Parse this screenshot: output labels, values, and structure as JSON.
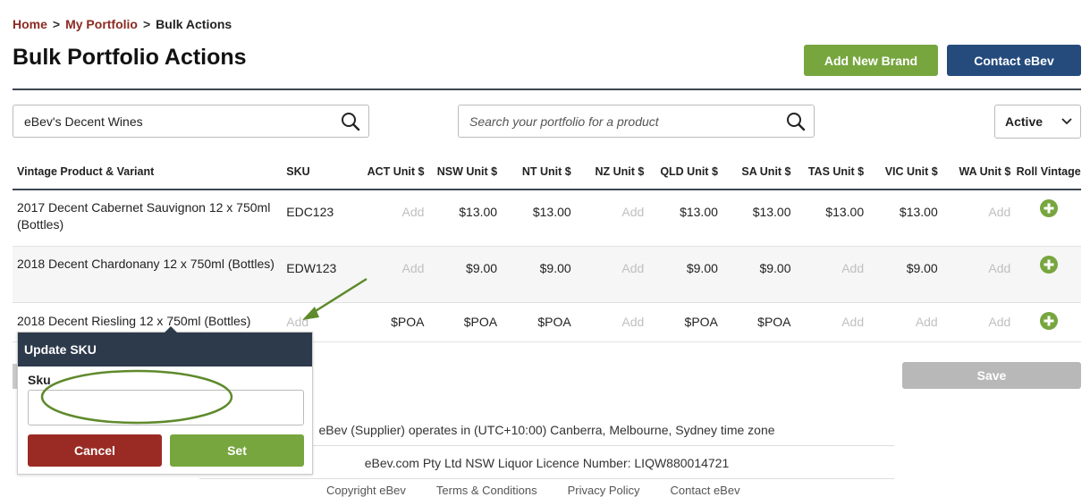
{
  "breadcrumb": {
    "home": "Home",
    "portfolio": "My Portfolio",
    "current": "Bulk Actions",
    "separator": ">"
  },
  "page_title": "Bulk Portfolio Actions",
  "buttons": {
    "add_brand": "Add New Brand",
    "contact": "Contact eBev",
    "save": "Save"
  },
  "brand_search": {
    "value": "eBev's Decent Wines",
    "icon": "search-icon"
  },
  "product_search": {
    "placeholder": "Search your portfolio for a product",
    "icon": "search-icon"
  },
  "status_filter": {
    "selected": "Active",
    "icon": "chevron-down-icon"
  },
  "table": {
    "headers": [
      "Vintage Product & Variant",
      "SKU",
      "ACT Unit $",
      "NSW Unit $",
      "NT Unit $",
      "NZ Unit $",
      "QLD Unit $",
      "SA Unit $",
      "TAS Unit $",
      "VIC Unit $",
      "WA Unit $",
      "Roll Vintage"
    ],
    "rows": [
      {
        "product": "2017 Decent Cabernet Sauvignon 12 x 750ml (Bottles)",
        "sku": "EDC123",
        "prices": [
          "Add",
          "$13.00",
          "$13.00",
          "Add",
          "$13.00",
          "$13.00",
          "$13.00",
          "$13.00",
          "Add"
        ]
      },
      {
        "product": "2018 Decent Chardonany 12 x 750ml (Bottles)",
        "sku": "EDW123",
        "prices": [
          "Add",
          "$9.00",
          "$9.00",
          "Add",
          "$9.00",
          "$9.00",
          "Add",
          "$9.00",
          "Add"
        ]
      },
      {
        "product": "2018 Decent Riesling 12 x 750ml (Bottles)",
        "sku": "Add",
        "prices": [
          "$POA",
          "$POA",
          "$POA",
          "Add",
          "$POA",
          "$POA",
          "Add",
          "Add",
          "Add"
        ]
      }
    ]
  },
  "popup": {
    "title": "Update SKU",
    "label": "Sku",
    "value": "",
    "cancel": "Cancel",
    "set": "Set"
  },
  "footer": {
    "timezone": "eBev (Supplier) operates in (UTC+10:00) Canberra, Melbourne, Sydney time zone",
    "licence": "eBev.com Pty Ltd NSW Liquor Licence Number: LIQW880014721",
    "links": [
      "Copyright eBev",
      "Terms & Conditions",
      "Privacy Policy",
      "Contact eBev"
    ]
  },
  "colors": {
    "brand_red": "#8b2a23",
    "green": "#77a63f",
    "navy": "#254b7d",
    "header_dark": "#2d3a4b",
    "cancel_red": "#9a2b24",
    "annotation_green": "#5f8a2c"
  }
}
